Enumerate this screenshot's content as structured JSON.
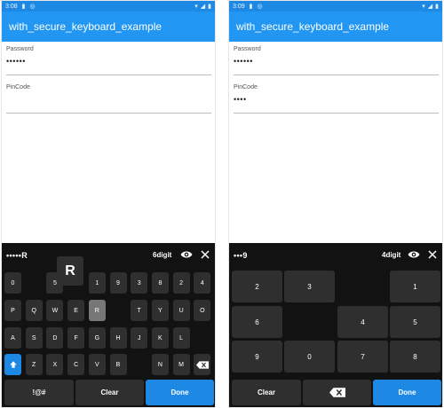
{
  "screens": [
    {
      "status_time": "3:08",
      "app_title": "with_secure_keyboard_example",
      "password_label": "Password",
      "password_value": "••••••",
      "pincode_label": "PinCode",
      "pincode_value": "",
      "kb_text": "•••••R",
      "kb_digit": "6digit",
      "popup_key": "R",
      "rows": [
        [
          "0",
          "",
          "5",
          "",
          "1",
          "9",
          "3",
          "8",
          "2",
          "4"
        ],
        [
          "P",
          "Q",
          "W",
          "E",
          "R",
          "",
          "T",
          "Y",
          "U",
          "O"
        ],
        [
          "A",
          "S",
          "D",
          "F",
          "G",
          "H",
          "J",
          "K",
          "L"
        ],
        [
          "",
          "Z",
          "X",
          "C",
          "V",
          "B",
          "",
          "N",
          "M",
          ""
        ]
      ],
      "pressed_key": "R",
      "special_label": "!@#",
      "clear_label": "Clear",
      "done_label": "Done"
    },
    {
      "status_time": "3:09",
      "app_title": "with_secure_keyboard_example",
      "password_label": "Password",
      "password_value": "••••••",
      "pincode_label": "PinCode",
      "pincode_value": "••••",
      "kb_text": "•••9",
      "kb_digit": "4digit",
      "pin_rows": [
        [
          "2",
          "3",
          "",
          "1"
        ],
        [
          "6",
          "",
          "4",
          "5"
        ],
        [
          "9",
          "0",
          "7",
          "8"
        ]
      ],
      "clear_label": "Clear",
      "done_label": "Done"
    }
  ],
  "colors": {
    "accent": "#2196f3",
    "status": "#1e88e5",
    "keyboard_bg": "#121212",
    "key_bg": "#2f2f2f"
  },
  "icons": [
    "eye-icon",
    "close-icon",
    "shift-icon",
    "backspace-icon",
    "wifi-icon",
    "signal-icon",
    "battery-icon"
  ]
}
